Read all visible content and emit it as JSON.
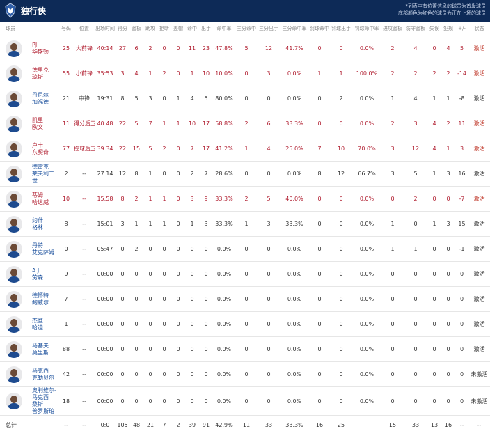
{
  "header": {
    "team_name": "独行侠",
    "note_line1": "*列表中有位置信息的球员为首发球员",
    "note_line2": "底部颜色为红色的球员为正在上场的球员"
  },
  "columns": [
    "球员",
    "号码",
    "位置",
    "出场时间",
    "得分",
    "篮板",
    "助攻",
    "抢断",
    "盖帽",
    "命中",
    "出手",
    "命中率",
    "三分命中",
    "三分出手",
    "三分命中率",
    "罚球命中",
    "罚球出手",
    "罚球命中率",
    "进攻篮板",
    "防守篮板",
    "失误",
    "犯规",
    "+/-",
    "状态"
  ],
  "players": [
    {
      "name": "PJ\n华盛顿",
      "number": "25",
      "position": "大前锋",
      "minutes": "40:14",
      "pts": "27",
      "reb": "6",
      "ast": "2",
      "stl": "0",
      "blk": "0",
      "fgm": "11",
      "fga": "23",
      "fgp": "47.8%",
      "tpm": "5",
      "tpa": "12",
      "tpp": "41.7%",
      "ftm": "0",
      "fta": "0",
      "ftp": "0.0%",
      "oreb": "2",
      "dreb": "4",
      "tov": "0",
      "pf": "4",
      "pm": "5",
      "status": "激活",
      "starter": true
    },
    {
      "name": "德里克\n琼斯",
      "number": "55",
      "position": "小前锋",
      "minutes": "35:53",
      "pts": "3",
      "reb": "4",
      "ast": "1",
      "stl": "2",
      "blk": "0",
      "fgm": "1",
      "fga": "10",
      "fgp": "10.0%",
      "tpm": "0",
      "tpa": "3",
      "tpp": "0.0%",
      "ftm": "1",
      "fta": "1",
      "ftp": "100.0%",
      "oreb": "2",
      "dreb": "2",
      "tov": "2",
      "pf": "2",
      "pm": "-14",
      "status": "激活",
      "starter": true
    },
    {
      "name": "丹尼尔\n加福德",
      "number": "21",
      "position": "中锋",
      "minutes": "19:31",
      "pts": "8",
      "reb": "5",
      "ast": "3",
      "stl": "0",
      "blk": "1",
      "fgm": "4",
      "fga": "5",
      "fgp": "80.0%",
      "tpm": "0",
      "tpa": "0",
      "tpp": "0.0%",
      "ftm": "0",
      "fta": "2",
      "ftp": "0.0%",
      "oreb": "1",
      "dreb": "4",
      "tov": "1",
      "pf": "1",
      "pm": "-8",
      "status": "激活",
      "starter": false
    },
    {
      "name": "凯里\n欧文",
      "number": "11",
      "position": "得分后卫",
      "minutes": "40:48",
      "pts": "22",
      "reb": "5",
      "ast": "7",
      "stl": "1",
      "blk": "1",
      "fgm": "10",
      "fga": "17",
      "fgp": "58.8%",
      "tpm": "2",
      "tpa": "6",
      "tpp": "33.3%",
      "ftm": "0",
      "fta": "0",
      "ftp": "0.0%",
      "oreb": "2",
      "dreb": "3",
      "tov": "4",
      "pf": "2",
      "pm": "11",
      "status": "激活",
      "starter": true
    },
    {
      "name": "卢卡\n东契奇",
      "number": "77",
      "position": "控球后卫",
      "minutes": "39:34",
      "pts": "22",
      "reb": "15",
      "ast": "5",
      "stl": "2",
      "blk": "0",
      "fgm": "7",
      "fga": "17",
      "fgp": "41.2%",
      "tpm": "1",
      "tpa": "4",
      "tpp": "25.0%",
      "ftm": "7",
      "fta": "10",
      "ftp": "70.0%",
      "oreb": "3",
      "dreb": "12",
      "tov": "4",
      "pf": "1",
      "pm": "3",
      "status": "激活",
      "starter": true
    },
    {
      "name": "德雷克\n莱夫利二世",
      "number": "2",
      "position": "--",
      "minutes": "27:14",
      "pts": "12",
      "reb": "8",
      "ast": "1",
      "stl": "0",
      "blk": "0",
      "fgm": "2",
      "fga": "7",
      "fgp": "28.6%",
      "tpm": "0",
      "tpa": "0",
      "tpp": "0.0%",
      "ftm": "8",
      "fta": "12",
      "ftp": "66.7%",
      "oreb": "3",
      "dreb": "5",
      "tov": "1",
      "pf": "3",
      "pm": "16",
      "status": "激活",
      "starter": false
    },
    {
      "name": "蒂姆\n哈达威",
      "number": "10",
      "position": "--",
      "minutes": "15:58",
      "pts": "8",
      "reb": "2",
      "ast": "1",
      "stl": "1",
      "blk": "0",
      "fgm": "3",
      "fga": "9",
      "fgp": "33.3%",
      "tpm": "2",
      "tpa": "5",
      "tpp": "40.0%",
      "ftm": "0",
      "fta": "0",
      "ftp": "0.0%",
      "oreb": "0",
      "dreb": "2",
      "tov": "0",
      "pf": "0",
      "pm": "-7",
      "status": "激活",
      "starter": true
    },
    {
      "name": "约什\n格林",
      "number": "8",
      "position": "--",
      "minutes": "15:01",
      "pts": "3",
      "reb": "1",
      "ast": "1",
      "stl": "1",
      "blk": "0",
      "fgm": "1",
      "fga": "3",
      "fgp": "33.3%",
      "tpm": "1",
      "tpa": "3",
      "tpp": "33.3%",
      "ftm": "0",
      "fta": "0",
      "ftp": "0.0%",
      "oreb": "1",
      "dreb": "0",
      "tov": "1",
      "pf": "3",
      "pm": "15",
      "status": "激活",
      "starter": false
    },
    {
      "name": "丹特\n艾克萨姆",
      "number": "0",
      "position": "--",
      "minutes": "05:47",
      "pts": "0",
      "reb": "2",
      "ast": "0",
      "stl": "0",
      "blk": "0",
      "fgm": "0",
      "fga": "0",
      "fgp": "0.0%",
      "tpm": "0",
      "tpa": "0",
      "tpp": "0.0%",
      "ftm": "0",
      "fta": "0",
      "ftp": "0.0%",
      "oreb": "1",
      "dreb": "1",
      "tov": "0",
      "pf": "0",
      "pm": "-1",
      "status": "激活",
      "starter": false
    },
    {
      "name": "A.J.\n劳森",
      "number": "9",
      "position": "--",
      "minutes": "00:00",
      "pts": "0",
      "reb": "0",
      "ast": "0",
      "stl": "0",
      "blk": "0",
      "fgm": "0",
      "fga": "0",
      "fgp": "0.0%",
      "tpm": "0",
      "tpa": "0",
      "tpp": "0.0%",
      "ftm": "0",
      "fta": "0",
      "ftp": "0.0%",
      "oreb": "0",
      "dreb": "0",
      "tov": "0",
      "pf": "0",
      "pm": "0",
      "status": "激活",
      "starter": false
    },
    {
      "name": "德怀特\n鲍威尔",
      "number": "7",
      "position": "--",
      "minutes": "00:00",
      "pts": "0",
      "reb": "0",
      "ast": "0",
      "stl": "0",
      "blk": "0",
      "fgm": "0",
      "fga": "0",
      "fgp": "0.0%",
      "tpm": "0",
      "tpa": "0",
      "tpp": "0.0%",
      "ftm": "0",
      "fta": "0",
      "ftp": "0.0%",
      "oreb": "0",
      "dreb": "0",
      "tov": "0",
      "pf": "0",
      "pm": "0",
      "status": "激活",
      "starter": false
    },
    {
      "name": "杰登\n哈迪",
      "number": "1",
      "position": "--",
      "minutes": "00:00",
      "pts": "0",
      "reb": "0",
      "ast": "0",
      "stl": "0",
      "blk": "0",
      "fgm": "0",
      "fga": "0",
      "fgp": "0.0%",
      "tpm": "0",
      "tpa": "0",
      "tpp": "0.0%",
      "ftm": "0",
      "fta": "0",
      "ftp": "0.0%",
      "oreb": "0",
      "dreb": "0",
      "tov": "0",
      "pf": "0",
      "pm": "0",
      "status": "激活",
      "starter": false
    },
    {
      "name": "马基夫\n莫里斯",
      "number": "88",
      "position": "--",
      "minutes": "00:00",
      "pts": "0",
      "reb": "0",
      "ast": "0",
      "stl": "0",
      "blk": "0",
      "fgm": "0",
      "fga": "0",
      "fgp": "0.0%",
      "tpm": "0",
      "tpa": "0",
      "tpp": "0.0%",
      "ftm": "0",
      "fta": "0",
      "ftp": "0.0%",
      "oreb": "0",
      "dreb": "0",
      "tov": "0",
      "pf": "0",
      "pm": "0",
      "status": "激活",
      "starter": false
    },
    {
      "name": "马克西\n克勒贝尔",
      "number": "42",
      "position": "--",
      "minutes": "00:00",
      "pts": "0",
      "reb": "0",
      "ast": "0",
      "stl": "0",
      "blk": "0",
      "fgm": "0",
      "fga": "0",
      "fgp": "0.0%",
      "tpm": "0",
      "tpa": "0",
      "tpp": "0.0%",
      "ftm": "0",
      "fta": "0",
      "ftp": "0.0%",
      "oreb": "0",
      "dreb": "0",
      "tov": "0",
      "pf": "0",
      "pm": "0",
      "status": "未激活",
      "starter": false
    },
    {
      "name": "奥利维尔-马克西\n桑斯\n普罗斯珀",
      "number": "18",
      "position": "--",
      "minutes": "00:00",
      "pts": "0",
      "reb": "0",
      "ast": "0",
      "stl": "0",
      "blk": "0",
      "fgm": "0",
      "fga": "0",
      "fgp": "0.0%",
      "tpm": "0",
      "tpa": "0",
      "tpp": "0.0%",
      "ftm": "0",
      "fta": "0",
      "ftp": "0.0%",
      "oreb": "0",
      "dreb": "0",
      "tov": "0",
      "pf": "0",
      "pm": "0",
      "status": "未激活",
      "starter": false
    }
  ],
  "totals": {
    "label": "总计",
    "number": "--",
    "position": "--",
    "minutes": "0:0",
    "pts": "105",
    "reb": "48",
    "ast": "21",
    "stl": "7",
    "blk": "2",
    "fgm": "39",
    "fga": "91",
    "fgp": "42.9%",
    "tpm": "11",
    "tpa": "33",
    "tpp": "33.3%",
    "ftm": "16",
    "fta": "25",
    "ftp": "",
    "oreb": "15",
    "dreb": "33",
    "tov": "13",
    "pf": "16",
    "pm": "--",
    "status": "--"
  },
  "colors": {
    "header_bg": "#0d2a57",
    "starter_red": "#b01c2e",
    "name_blue": "#1a4f9c"
  }
}
